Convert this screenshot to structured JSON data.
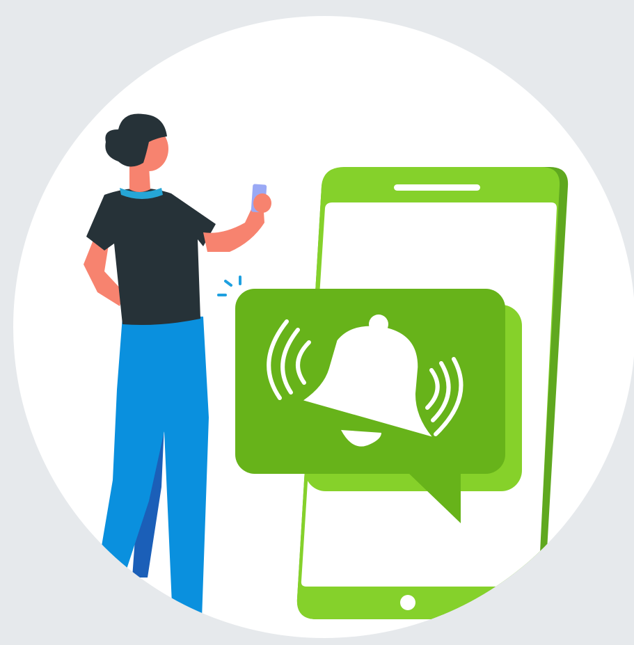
{
  "illustration": {
    "icons": [
      "bell-icon",
      "vibration-waves-icon",
      "smartphone-icon",
      "person-figure"
    ],
    "colors": {
      "background": "#e6e9ec",
      "circle": "#ffffff",
      "phone_body": "#85d12b",
      "phone_dark": "#5fa81f",
      "bubble": "#67b31a",
      "bubble_back": "#86d12a",
      "bell": "#ffffff",
      "shirt": "#263238",
      "pants": "#0a90de",
      "skin": "#f7836f",
      "hair": "#263238",
      "collar": "#26a6d6",
      "handheld_phone": "#9aa9f5",
      "sparks": "#1ea0e0"
    }
  }
}
